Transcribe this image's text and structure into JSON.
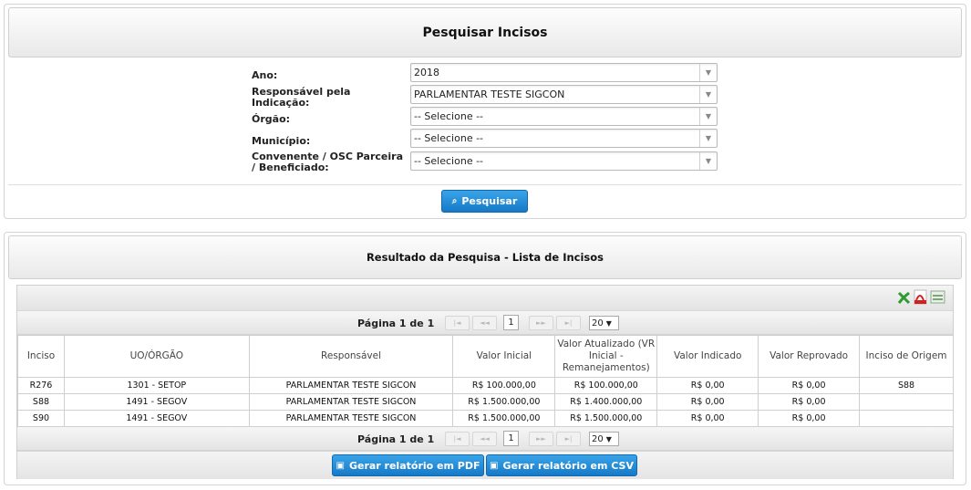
{
  "search": {
    "title": "Pesquisar Incisos",
    "fields": [
      {
        "label": "Ano:",
        "value": "2018"
      },
      {
        "label": "Responsável pela Indicação:",
        "value": "PARLAMENTAR TESTE SIGCON"
      },
      {
        "label": "Órgão:",
        "value": "-- Selecione --"
      },
      {
        "label": "Município:",
        "value": "-- Selecione --"
      },
      {
        "label": "Convenente / OSC Parceira / Beneficiado:",
        "value": "-- Selecione --"
      }
    ],
    "search_button": "Pesquisar"
  },
  "results": {
    "title": "Resultado da Pesquisa - Lista de Incisos",
    "pager": {
      "page_text": "Página 1 de 1",
      "current_page": "1",
      "page_size": "20"
    },
    "columns": [
      "Inciso",
      "UO/ÓRGÃO",
      "Responsável",
      "Valor Inicial",
      "Valor Atualizado (VR Inicial - Remanejamentos)",
      "Valor Indicado",
      "Valor Reprovado",
      "Inciso de Origem"
    ],
    "rows": [
      [
        "R276",
        "1301 - SETOP",
        "PARLAMENTAR TESTE SIGCON",
        "R$ 100.000,00",
        "R$ 100.000,00",
        "R$ 0,00",
        "R$ 0,00",
        "S88"
      ],
      [
        "S88",
        "1491 - SEGOV",
        "PARLAMENTAR TESTE SIGCON",
        "R$ 1.500.000,00",
        "R$ 1.400.000,00",
        "R$ 0,00",
        "R$ 0,00",
        ""
      ],
      [
        "S90",
        "1491 - SEGOV",
        "PARLAMENTAR TESTE SIGCON",
        "R$ 1.500.000,00",
        "R$ 1.500.000,00",
        "R$ 0,00",
        "R$ 0,00",
        ""
      ]
    ],
    "pdf_button": "Gerar relatório em PDF",
    "csv_button": "Gerar relatório em CSV",
    "export_icons": [
      "excel-icon",
      "pdf-icon",
      "csv-icon"
    ]
  },
  "colors": {
    "button_blue": "#1f8ad8",
    "border": "#d4d4d4"
  }
}
